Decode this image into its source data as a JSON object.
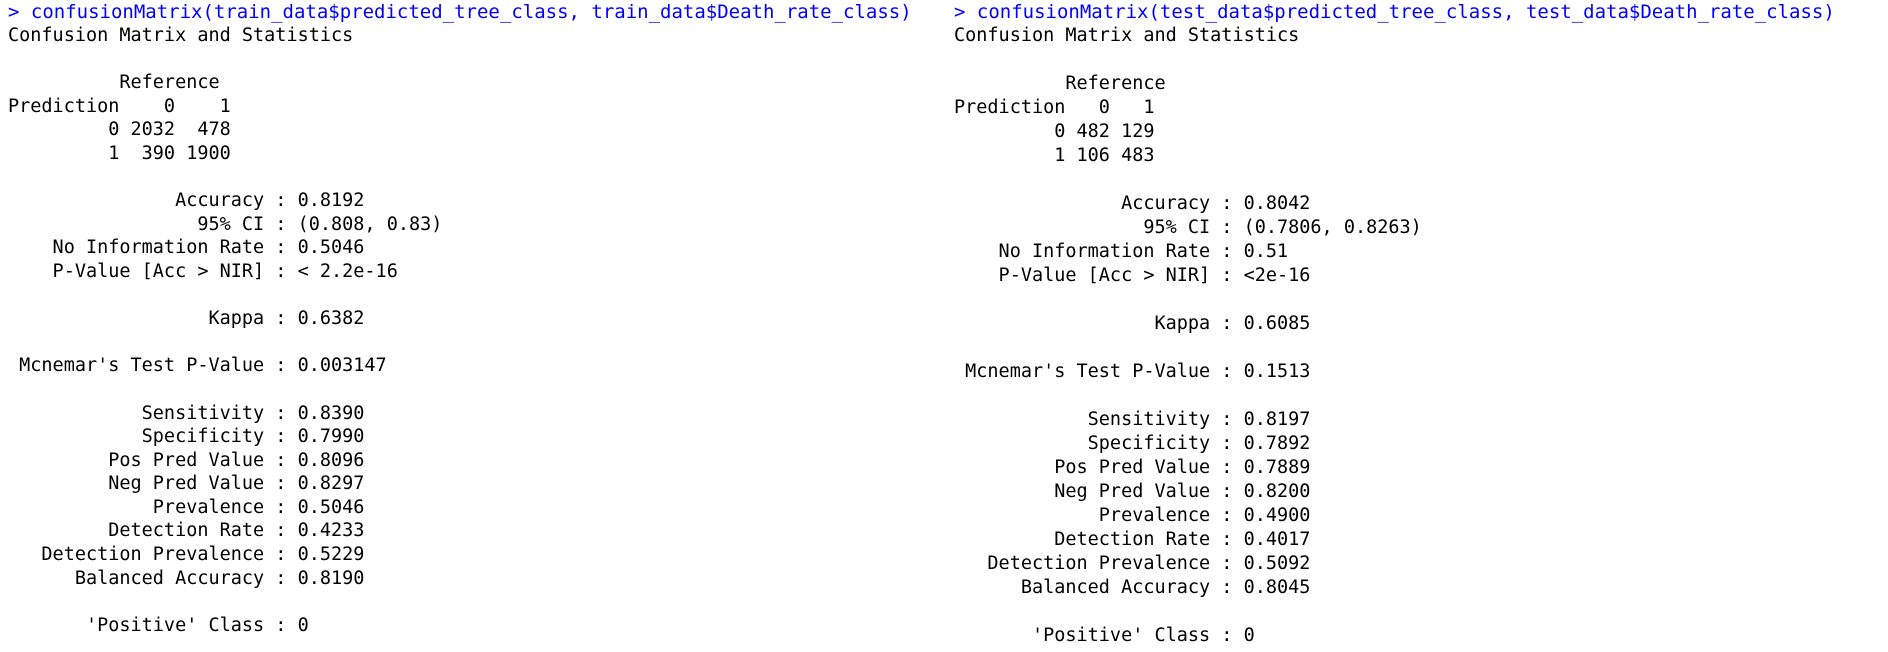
{
  "left": {
    "command": "> confusionMatrix(train_data$predicted_tree_class, train_data$Death_rate_class)",
    "output": "Confusion Matrix and Statistics\n\n          Reference\nPrediction    0    1\n         0 2032  478\n         1  390 1900\n\n               Accuracy : 0.8192\n                 95% CI : (0.808, 0.83)\n    No Information Rate : 0.5046\n    P-Value [Acc > NIR] : < 2.2e-16\n\n                  Kappa : 0.6382\n\n Mcnemar's Test P-Value : 0.003147\n\n            Sensitivity : 0.8390\n            Specificity : 0.7990\n         Pos Pred Value : 0.8096\n         Neg Pred Value : 0.8297\n             Prevalence : 0.5046\n         Detection Rate : 0.4233\n   Detection Prevalence : 0.5229\n      Balanced Accuracy : 0.8190\n\n       'Positive' Class : 0"
  },
  "right": {
    "command": "> confusionMatrix(test_data$predicted_tree_class, test_data$Death_rate_class)",
    "output": "Confusion Matrix and Statistics\n\n          Reference\nPrediction   0   1\n         0 482 129\n         1 106 483\n\n               Accuracy : 0.8042\n                 95% CI : (0.7806, 0.8263)\n    No Information Rate : 0.51\n    P-Value [Acc > NIR] : <2e-16\n\n                  Kappa : 0.6085\n\n Mcnemar's Test P-Value : 0.1513\n\n            Sensitivity : 0.8197\n            Specificity : 0.7892\n         Pos Pred Value : 0.7889\n         Neg Pred Value : 0.8200\n             Prevalence : 0.4900\n         Detection Rate : 0.4017\n   Detection Prevalence : 0.5092\n      Balanced Accuracy : 0.8045\n\n       'Positive' Class : 0"
  }
}
